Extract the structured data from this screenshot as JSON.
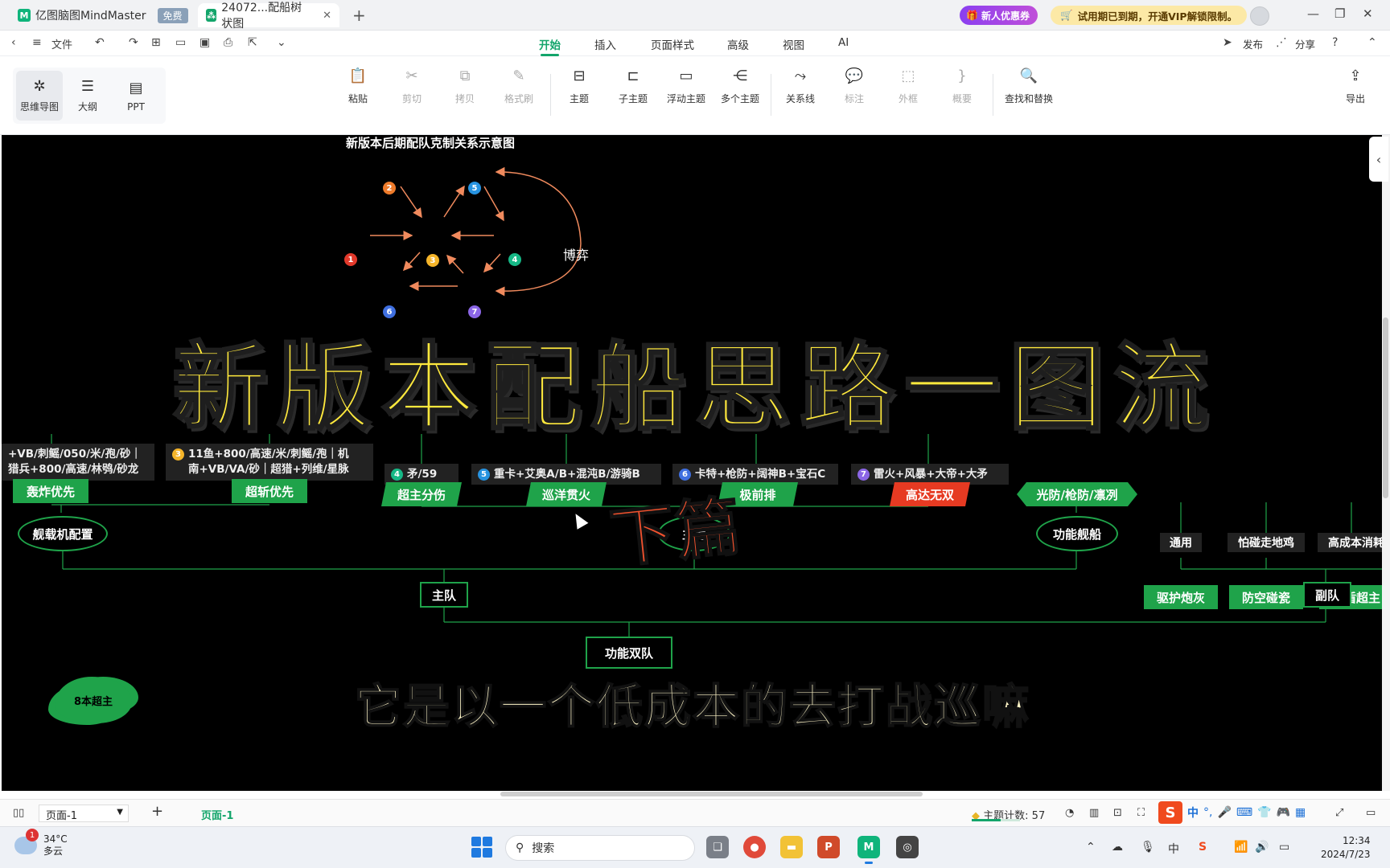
{
  "tabs": {
    "app": {
      "name": "亿图脑图MindMaster",
      "badge": "免费"
    },
    "doc": {
      "name": "24072...配船树状图"
    },
    "promo_coupon": "新人优惠券",
    "promo_vip": "试用期已到期，开通VIP解锁限制。"
  },
  "menu": {
    "file": "文件",
    "items": [
      "开始",
      "插入",
      "页面样式",
      "高级",
      "视图",
      "AI"
    ],
    "publish": "发布",
    "share": "分享"
  },
  "toolbar": {
    "views": [
      "思维导图",
      "大纲",
      "PPT"
    ],
    "buttons": [
      "粘贴",
      "剪切",
      "拷贝",
      "格式刷",
      "主题",
      "子主题",
      "浮动主题",
      "多个主题",
      "关系线",
      "标注",
      "外框",
      "概要",
      "查找和替换"
    ],
    "export": "导出"
  },
  "canvas": {
    "diagram_title": "新版本后期配队克制关系示意图",
    "nodes": [
      "1",
      "2",
      "3",
      "4",
      "5",
      "6",
      "7"
    ],
    "boyi": "博弈",
    "overlay_title": "新版本配船思路一图流",
    "overlay_sub": "下篇",
    "subtitle": "它是以一个低成本的去打战巡嘛",
    "cards": {
      "c1a": "+VB/刺鳐/050/米/孢/砂｜",
      "c1b": "猎兵+800/高速/林鸮/砂龙",
      "c2a": "11鱼+800/高速/米/刺鳐/孢｜机",
      "c2b": "南+VB/VA/砂｜超猎+列维/星脉",
      "c3": "矛/59",
      "c4": "重卡+艾奥A/B+混沌B/游骑B",
      "c5": "卡特+枪防+阔神B+宝石C",
      "c6": "雷火+风暴+大帝+大矛"
    },
    "card_nums": [
      "3",
      "4",
      "5",
      "6",
      "7"
    ],
    "leaves": {
      "bomb": "轰炸优先",
      "slash": "超斩优先",
      "super": "超主分伤",
      "cruise": "巡洋贯火",
      "front": "极前排",
      "gaoda": "高达无双",
      "func": "光防/枪防/凛冽",
      "escort": "驱护炮灰",
      "aa": "防空碰瓷",
      "tank": "奶盾超主"
    },
    "tags": {
      "general": "通用",
      "fear": "怕碰走地鸡",
      "cost": "高成本消耗"
    },
    "ovals": {
      "carrier": "舰载机配置",
      "main_partial": "主力",
      "func_ship": "功能舰船"
    },
    "boxes": {
      "main": "主队",
      "sub": "副队",
      "dual": "功能双队"
    },
    "cloud": "8本超主"
  },
  "status": {
    "page_select": "页面-1",
    "page_tab": "页面-1",
    "topic_count_label": "主题计数:",
    "topic_count": "57"
  },
  "ime": {
    "lang": "中"
  },
  "taskbar": {
    "temp": "34°C",
    "weather": "多云",
    "weather_badge": "1",
    "search": "搜索",
    "lang": "中",
    "time": "12:34",
    "date": "2024/7/23"
  },
  "colors": {
    "accent": "#13a56b",
    "canvas": "#000000",
    "node_green": "#1fa34a",
    "title_yellow": "#ffe93d"
  }
}
